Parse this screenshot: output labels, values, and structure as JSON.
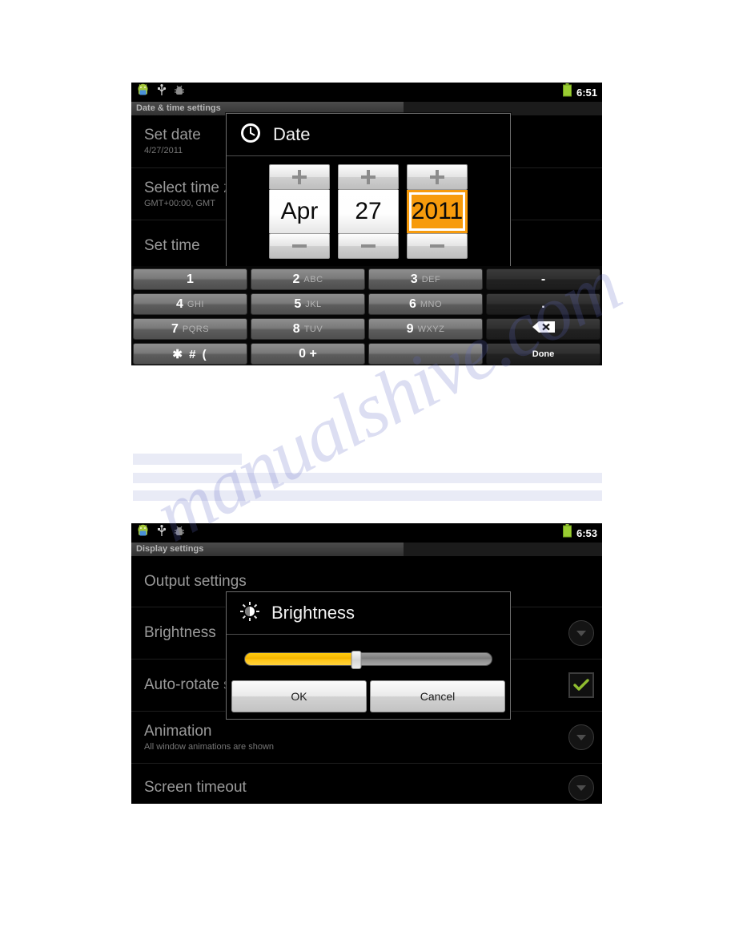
{
  "page": {
    "background": "#ffffff",
    "watermark_text": "manualshive.com"
  },
  "placeholder_bars": [
    {
      "name": "bar-short"
    },
    {
      "name": "bar-wide-1"
    },
    {
      "name": "bar-wide-2"
    }
  ],
  "screenshot_date": {
    "statusbar": {
      "icons": [
        "android-robot-icon",
        "usb-icon",
        "adb-bug-icon"
      ],
      "battery_icon": "battery-full-icon",
      "time": "6:51"
    },
    "titlebar": {
      "label": "Date & time settings"
    },
    "rows": [
      {
        "title": "Set date",
        "subtitle": "4/27/2011"
      },
      {
        "title": "Select time zone",
        "subtitle": "GMT+00:00, GMT"
      },
      {
        "title": "Set time",
        "subtitle": ""
      }
    ],
    "dialog": {
      "icon": "clock-icon",
      "title": "Date",
      "pickers": [
        {
          "name": "month",
          "plus": "+",
          "value": "Apr",
          "minus": "–",
          "selected": false
        },
        {
          "name": "day",
          "plus": "+",
          "value": "27",
          "minus": "–",
          "selected": false
        },
        {
          "name": "year",
          "plus": "+",
          "value": "2011",
          "minus": "–",
          "selected": true
        }
      ]
    },
    "keyboard": {
      "rows": [
        [
          {
            "main": "1",
            "sub": "",
            "style": "light"
          },
          {
            "main": "2",
            "sub": "ABC",
            "style": "light"
          },
          {
            "main": "3",
            "sub": "DEF",
            "style": "light"
          },
          {
            "main": "-",
            "sub": "",
            "style": "dark"
          }
        ],
        [
          {
            "main": "4",
            "sub": "GHI",
            "style": "light"
          },
          {
            "main": "5",
            "sub": "JKL",
            "style": "light"
          },
          {
            "main": "6",
            "sub": "MNO",
            "style": "light"
          },
          {
            "main": ".",
            "sub": "",
            "style": "dark"
          }
        ],
        [
          {
            "main": "7",
            "sub": "PQRS",
            "style": "light"
          },
          {
            "main": "8",
            "sub": "TUV",
            "style": "light"
          },
          {
            "main": "9",
            "sub": "WXYZ",
            "style": "light"
          },
          {
            "main": "backspace-icon",
            "sub": "",
            "style": "dark-icon"
          }
        ],
        [
          {
            "main": "✱ # (",
            "sub": "",
            "style": "light-sym"
          },
          {
            "main": "0 +",
            "sub": "",
            "style": "light"
          },
          {
            "main": "",
            "sub": "",
            "style": "light"
          },
          {
            "main": "Done",
            "sub": "",
            "style": "dark-small"
          }
        ]
      ]
    }
  },
  "screenshot_display": {
    "statusbar": {
      "icons": [
        "android-robot-icon",
        "usb-icon",
        "adb-bug-icon"
      ],
      "battery_icon": "battery-full-icon",
      "time": "6:53"
    },
    "titlebar": {
      "label": "Display settings"
    },
    "rows": [
      {
        "title": "Output settings",
        "subtitle": "",
        "widget": "none"
      },
      {
        "title": "Brightness",
        "subtitle": "",
        "widget": "dropdown"
      },
      {
        "title": "Auto-rotate screen",
        "subtitle": "",
        "widget": "checkbox-checked"
      },
      {
        "title": "Animation",
        "subtitle": "All window animations are shown",
        "widget": "dropdown"
      },
      {
        "title": "Screen timeout",
        "subtitle": "",
        "widget": "dropdown"
      }
    ],
    "dialog": {
      "icon": "brightness-sun-icon",
      "title": "Brightness",
      "slider": {
        "name": "brightness-slider",
        "value_percent": 45,
        "fill_color": "#f5b400",
        "track_color": "#8e8e8e"
      },
      "buttons": [
        {
          "label": "OK",
          "name": "ok-button"
        },
        {
          "label": "Cancel",
          "name": "cancel-button"
        }
      ]
    }
  }
}
